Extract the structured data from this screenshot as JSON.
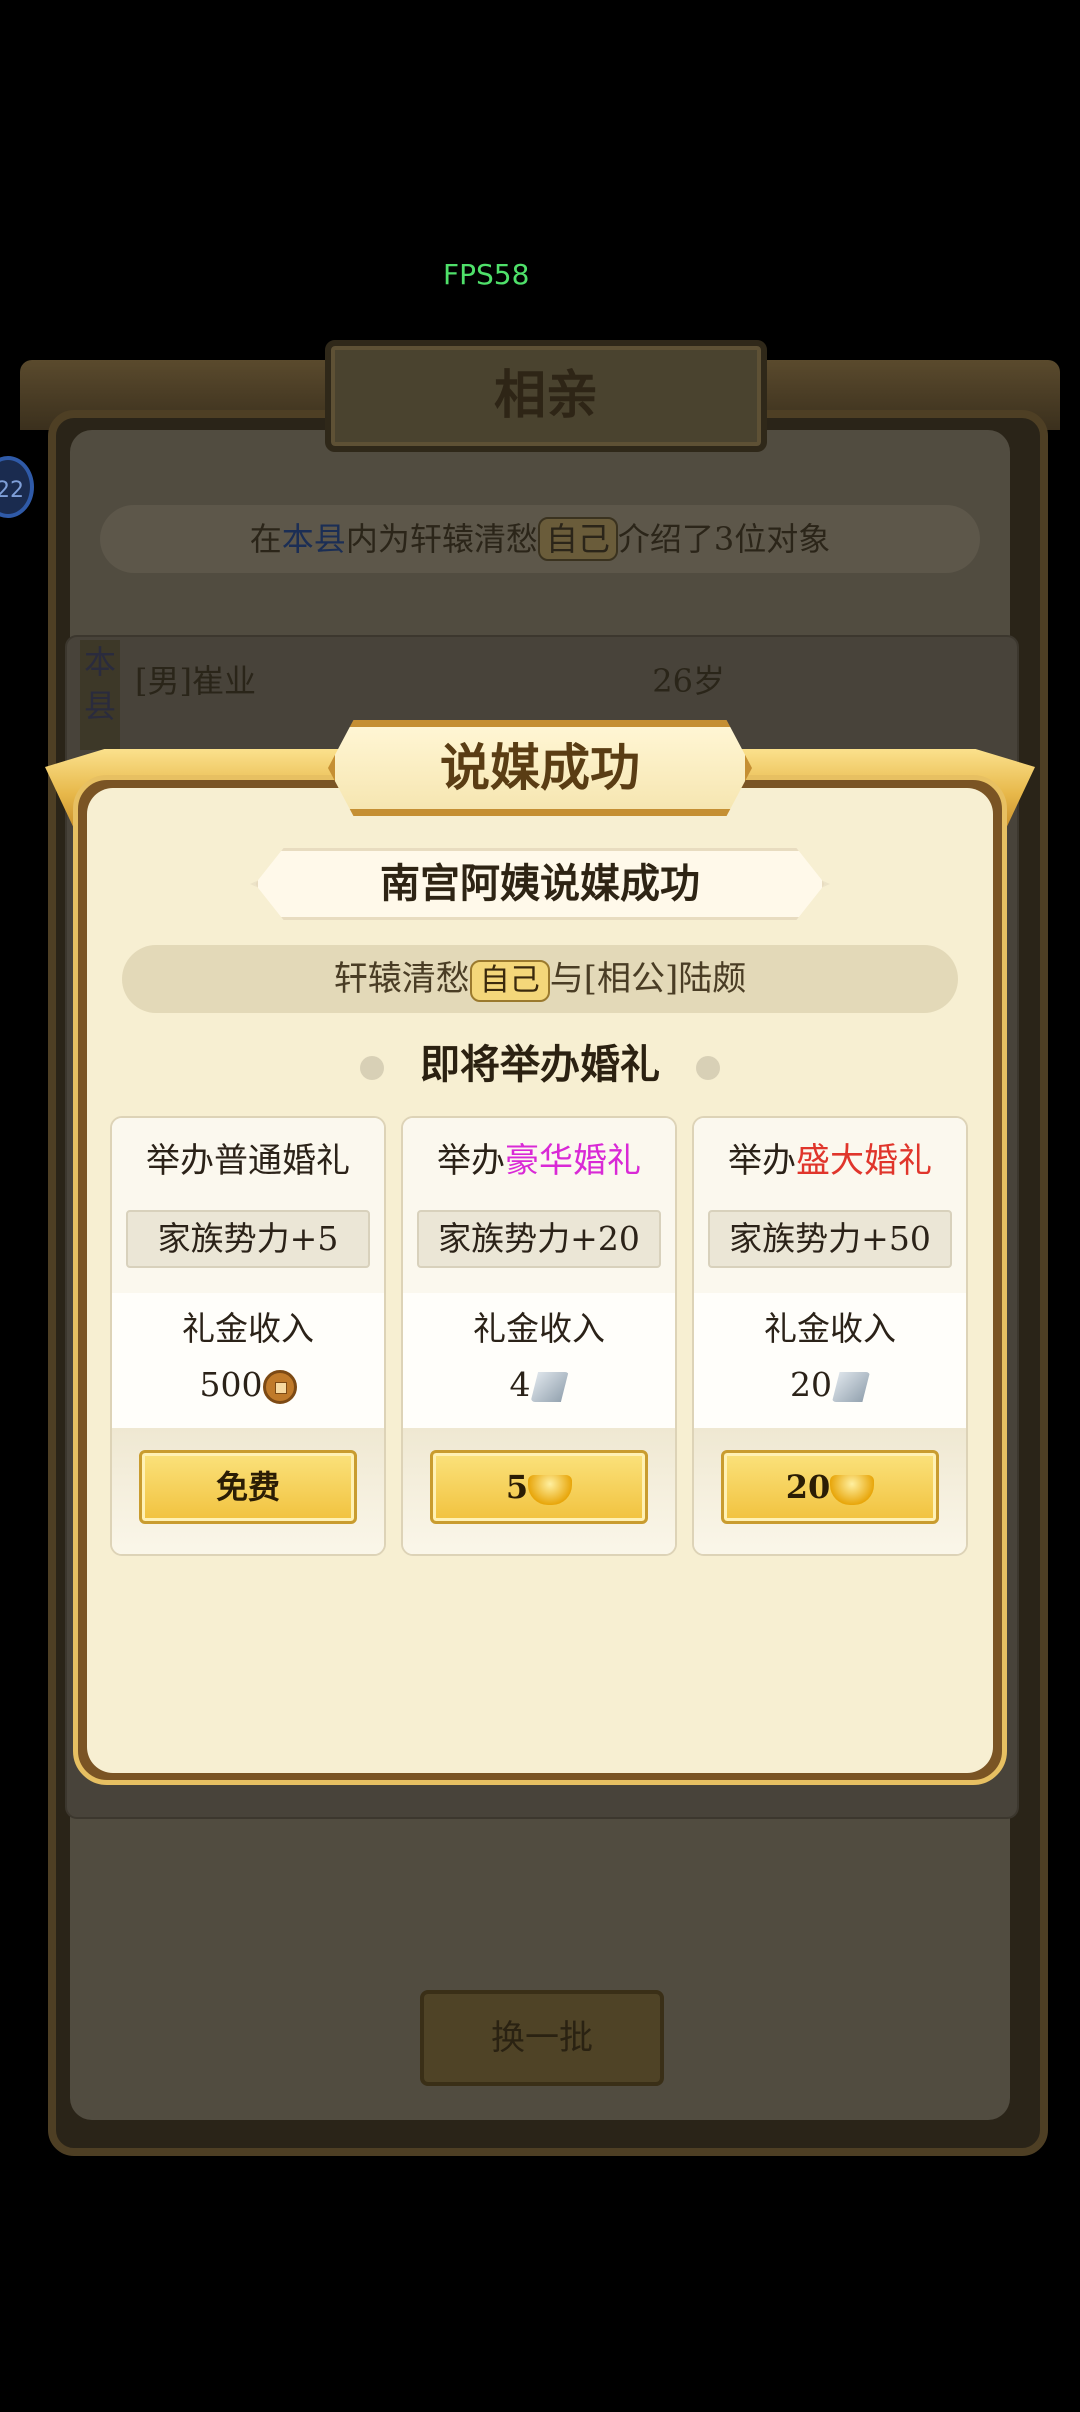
{
  "overlay": {
    "fps": "FPS58",
    "avatar_peek": "22"
  },
  "background_window": {
    "title": "相亲",
    "intro": {
      "prefix": "在",
      "county": "本县",
      "mid": "内为轩辕清愁",
      "self_tag": "自己",
      "suffix": "介绍了3位对象"
    },
    "county_tag": "本县",
    "candidate": {
      "label": "[男]崔业",
      "age": "26岁"
    },
    "refresh_button": "换一批"
  },
  "dialog": {
    "title": "说媒成功",
    "matchmaker_line": "南宫阿姨说媒成功",
    "couple": {
      "name": "轩辕清愁",
      "self_tag": "自己",
      "middle": "与",
      "partner": "[相公]陆颇"
    },
    "section_title": "即将举办婚礼",
    "gift_label": "礼金收入",
    "options": [
      {
        "name_prefix": "举办",
        "name_highlight": "普通婚礼",
        "highlight_color": "#2b2218",
        "power": "家族势力+5",
        "gift_amount": "500",
        "gift_icon": "copper-coin-icon",
        "button_label": "免费",
        "button_cost_icon": ""
      },
      {
        "name_prefix": "举办",
        "name_highlight": "豪华婚礼",
        "highlight_color": "#d929d6",
        "power": "家族势力+20",
        "gift_amount": "4",
        "gift_icon": "silver-ingot-icon",
        "button_label": "5",
        "button_cost_icon": "gold-ingot-icon"
      },
      {
        "name_prefix": "举办",
        "name_highlight": "盛大婚礼",
        "highlight_color": "#e0352b",
        "power": "家族势力+50",
        "gift_amount": "20",
        "gift_icon": "silver-ingot-icon",
        "button_label": "20",
        "button_cost_icon": "gold-ingot-icon"
      }
    ]
  }
}
